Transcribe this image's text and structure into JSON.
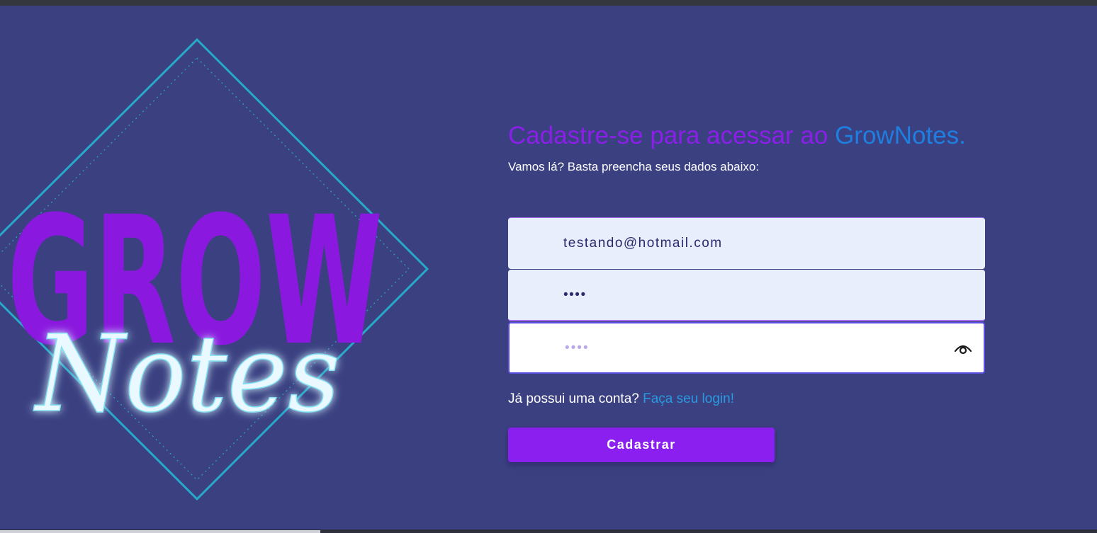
{
  "logo": {
    "line1": "GROW",
    "line2": "Notes"
  },
  "header": {
    "title": "Cadastre-se para acessar ao ",
    "title_brand": "GrowNotes.",
    "subtitle": "Vamos lá? Basta preencha seus dados abaixo:"
  },
  "form": {
    "email_value": "testando@hotmail.com",
    "password_value": "••••",
    "confirm_placeholder": "••••",
    "eye_icon": "eye-icon"
  },
  "footer": {
    "login_prompt": "Já possui uma conta?",
    "login_link": "Faça seu login!",
    "submit_label": "Cadastrar"
  },
  "colors": {
    "background": "#3b4081",
    "accent_purple": "#8a1ff0",
    "accent_blue": "#1e7fe0",
    "link_blue": "#2a9ae0"
  }
}
